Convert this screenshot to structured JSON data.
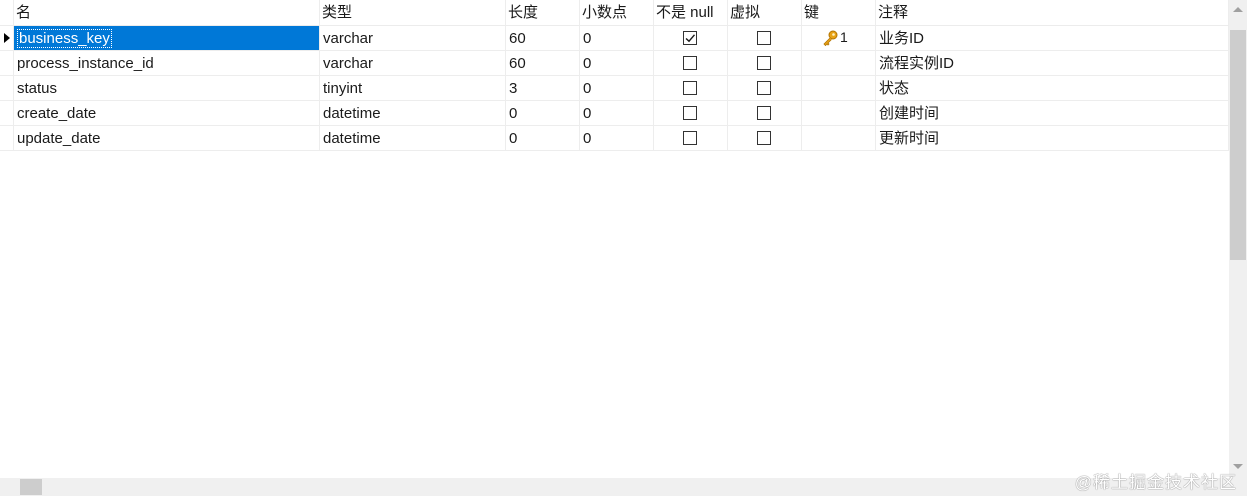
{
  "columns": {
    "name": "名",
    "type": "类型",
    "length": "长度",
    "decimals": "小数点",
    "not_null": "不是 null",
    "virtual": "虚拟",
    "key": "键",
    "comment": "注释"
  },
  "rows": [
    {
      "name": "business_key",
      "type": "varchar",
      "length": "60",
      "decimals": "0",
      "not_null": true,
      "virtual": false,
      "key": "1",
      "comment": "业务ID"
    },
    {
      "name": "process_instance_id",
      "type": "varchar",
      "length": "60",
      "decimals": "0",
      "not_null": false,
      "virtual": false,
      "key": "",
      "comment": "流程实例ID"
    },
    {
      "name": "status",
      "type": "tinyint",
      "length": "3",
      "decimals": "0",
      "not_null": false,
      "virtual": false,
      "key": "",
      "comment": "状态"
    },
    {
      "name": "create_date",
      "type": "datetime",
      "length": "0",
      "decimals": "0",
      "not_null": false,
      "virtual": false,
      "key": "",
      "comment": "创建时间"
    },
    {
      "name": "update_date",
      "type": "datetime",
      "length": "0",
      "decimals": "0",
      "not_null": false,
      "virtual": false,
      "key": "",
      "comment": "更新时间"
    }
  ],
  "selected_row": 0,
  "icons": {
    "row_pointer": "row-pointer-icon",
    "primary_key": "key-icon",
    "checkbox": "checkbox-icon"
  },
  "colors": {
    "selection": "#0078d7",
    "key_icon": "#e8a317"
  },
  "watermark": "@稀土掘金技术社区"
}
